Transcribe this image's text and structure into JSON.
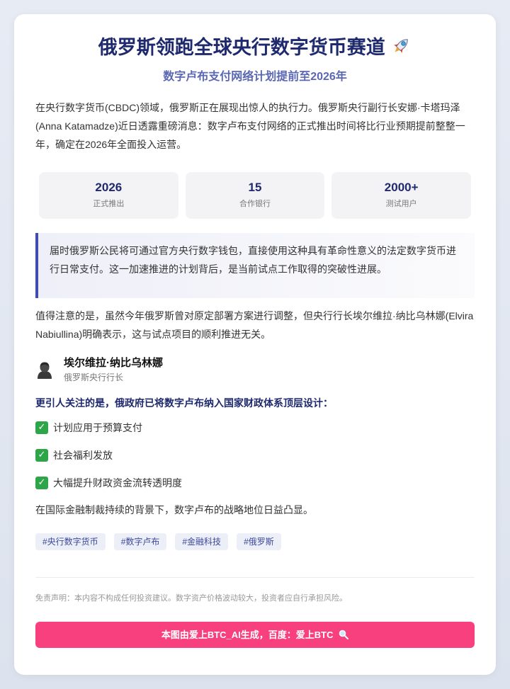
{
  "header": {
    "title": "俄罗斯领跑全球央行数字货币赛道",
    "title_icon": "rocket-icon",
    "subtitle": "数字卢布支付网络计划提前至2026年"
  },
  "intro": "在央行数字货币(CBDC)领域，俄罗斯正在展现出惊人的执行力。俄罗斯央行副行长安娜·卡塔玛泽(Anna Katamadze)近日透露重磅消息：数字卢布支付网络的正式推出时间将比行业预期提前整整一年，确定在2026年全面投入运营。",
  "stats": [
    {
      "value": "2026",
      "label": "正式推出"
    },
    {
      "value": "15",
      "label": "合作银行"
    },
    {
      "value": "2000+",
      "label": "测试用户"
    }
  ],
  "quote": "届时俄罗斯公民将可通过官方央行数字钱包，直接使用这种具有革命性意义的法定数字货币进行日常支付。这一加速推进的计划背后，是当前试点工作取得的突破性进展。",
  "paragraph2": "值得注意的是，虽然今年俄罗斯曾对原定部署方案进行调整，但央行行长埃尔维拉·纳比乌林娜(Elvira Nabiullina)明确表示，这与试点项目的顺利推进无关。",
  "person": {
    "icon": "person-avatar-icon",
    "name": "埃尔维拉·纳比乌林娜",
    "role": "俄罗斯央行行长"
  },
  "highlight": "更引人关注的是，俄政府已将数字卢布纳入国家财政体系顶层设计：",
  "checklist": [
    {
      "icon": "check-icon",
      "text": "计划应用于预算支付"
    },
    {
      "icon": "check-icon",
      "text": "社会福利发放"
    },
    {
      "icon": "check-icon",
      "text": "大幅提升财政资金流转透明度"
    }
  ],
  "paragraph3": "在国际金融制裁持续的背景下，数字卢布的战略地位日益凸显。",
  "tags": [
    "#央行数字货币",
    "#数字卢布",
    "#金融科技",
    "#俄罗斯"
  ],
  "disclaimer": "免责声明：本内容不构成任何投资建议。数字资产价格波动较大，投资者应自行承担风险。",
  "cta": {
    "label": "本图由爱上BTC_AI生成，百度：爱上BTC",
    "icon": "magnifier-icon"
  },
  "colors": {
    "title": "#1f2a6e",
    "subtitle": "#5a67b2",
    "accent_bar": "#3f4db0",
    "cta_background": "#f8407e",
    "check_green": "#2fa54a"
  }
}
